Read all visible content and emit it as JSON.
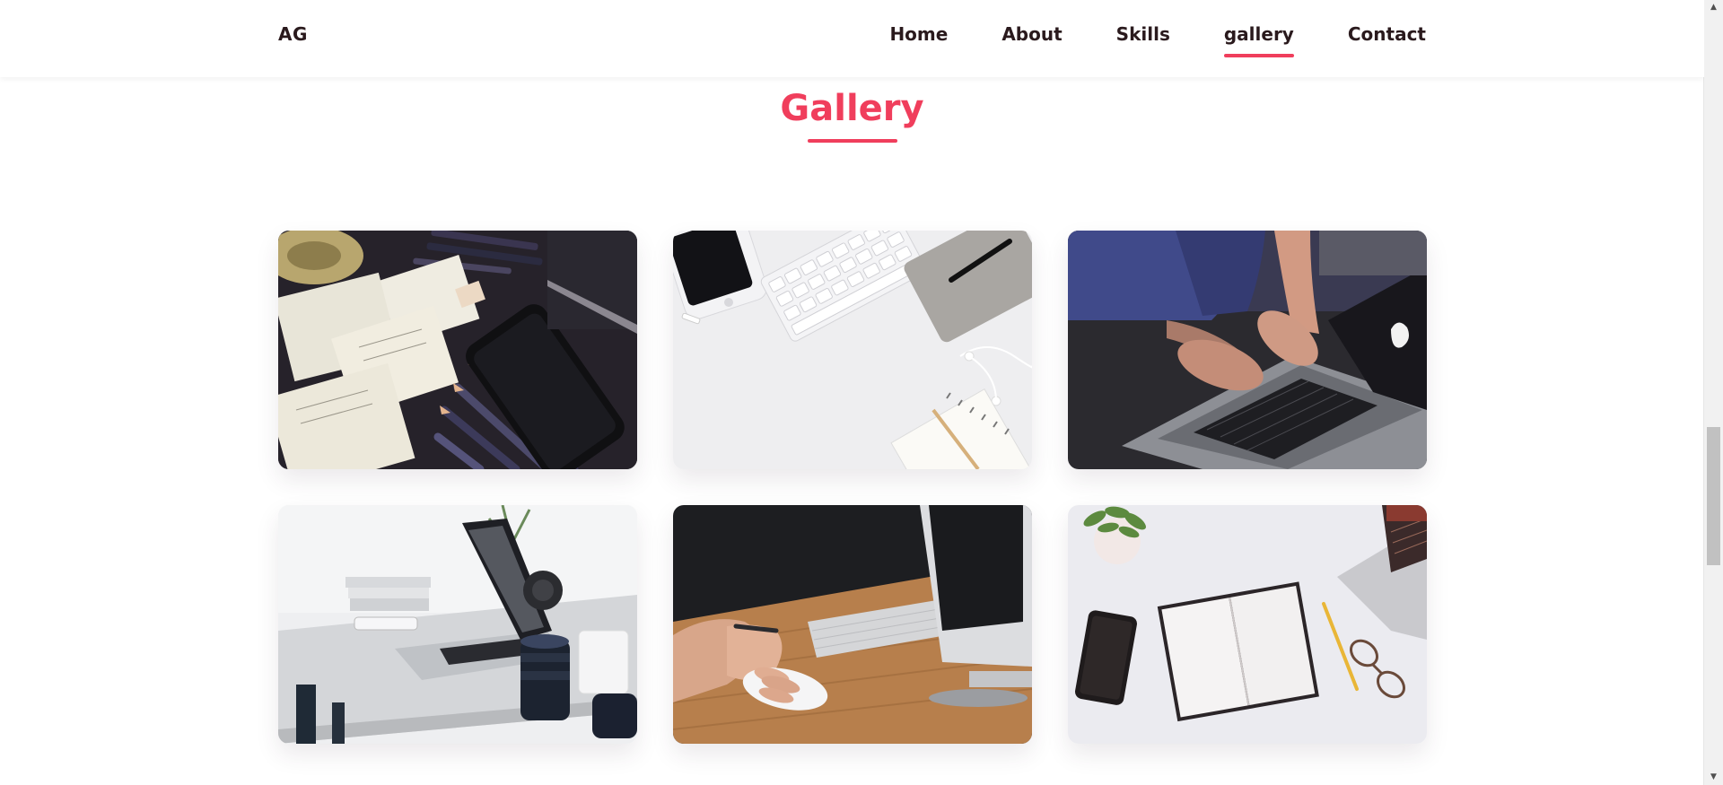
{
  "header": {
    "logo": "AG",
    "nav": [
      {
        "label": "Home"
      },
      {
        "label": "About"
      },
      {
        "label": "Skills"
      },
      {
        "label": "gallery",
        "active": true
      },
      {
        "label": "Contact"
      }
    ]
  },
  "section": {
    "title": "Gallery"
  },
  "colors": {
    "accent": "#f03e5c",
    "text": "#2a1a1d",
    "background": "#ffffff"
  },
  "gallery": {
    "images": [
      {
        "name": "desk-wireframes-pencils-phone-image"
      },
      {
        "name": "white-keyboard-phone-notebook-image"
      },
      {
        "name": "hands-typing-laptop-image"
      },
      {
        "name": "laptop-on-desk-camera-lens-image"
      },
      {
        "name": "hand-mouse-keyboard-monitor-image"
      },
      {
        "name": "notebook-phone-glasses-laptop-image"
      }
    ]
  }
}
